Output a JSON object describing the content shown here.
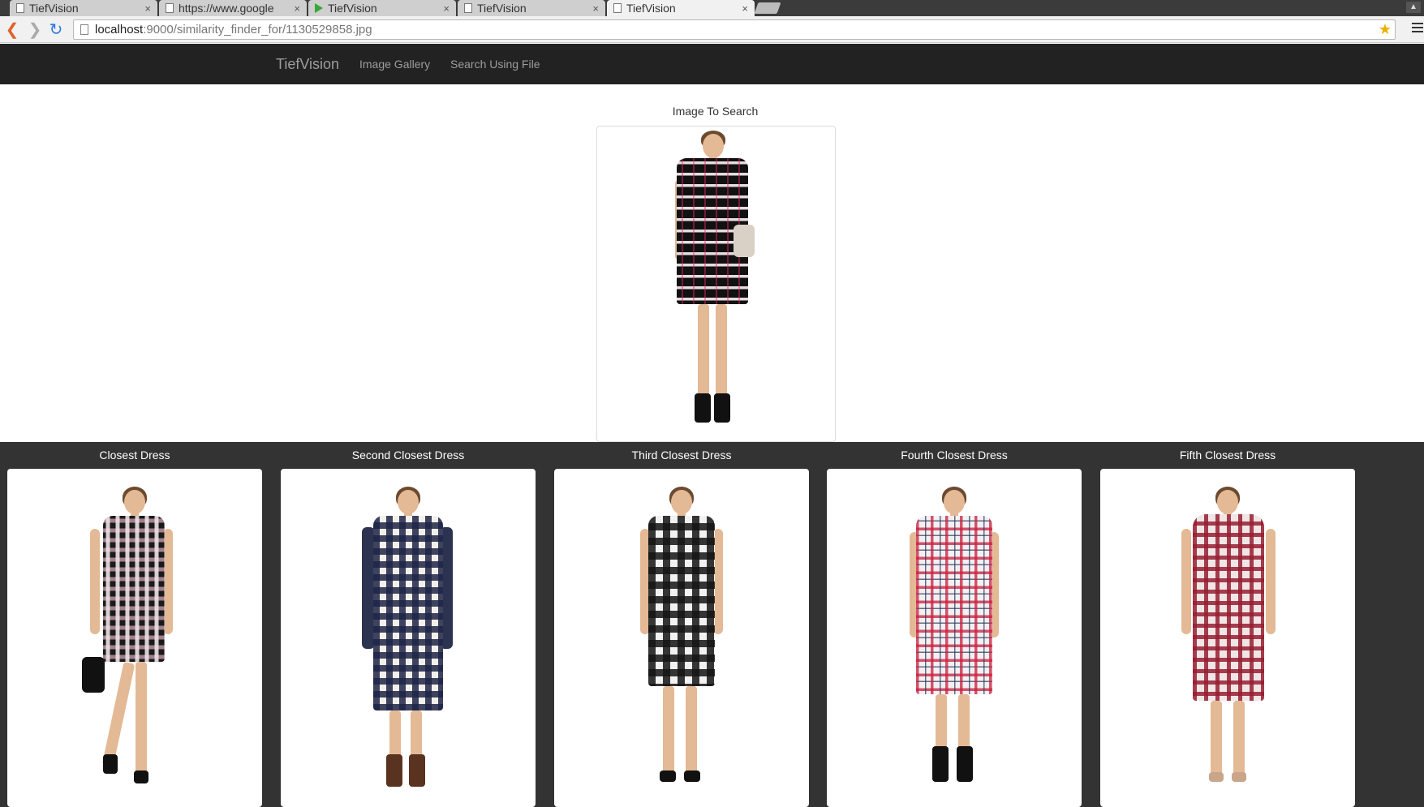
{
  "browser": {
    "tabs": [
      {
        "label": "TiefVision",
        "icon": "document-icon",
        "active": false
      },
      {
        "label": "https://www.google",
        "icon": "document-icon",
        "active": false
      },
      {
        "label": "TiefVision",
        "icon": "play-icon",
        "active": false
      },
      {
        "label": "TiefVision",
        "icon": "document-icon",
        "active": false
      },
      {
        "label": "TiefVision",
        "icon": "document-icon",
        "active": true
      }
    ],
    "tab_close_glyph": "×",
    "url_host": "localhost",
    "url_path": ":9000/similarity_finder_for/1130529858.jpg"
  },
  "navbar": {
    "brand": "TiefVision",
    "links": [
      "Image Gallery",
      "Search Using File"
    ]
  },
  "query": {
    "title": "Image To Search"
  },
  "results": [
    {
      "title": "Closest Dress"
    },
    {
      "title": "Second Closest Dress"
    },
    {
      "title": "Third Closest Dress"
    },
    {
      "title": "Fourth Closest Dress"
    },
    {
      "title": "Fifth Closest Dress"
    }
  ],
  "colors": {
    "navbar_bg": "#222222",
    "results_bg": "#333333",
    "brand_text": "#9d9d9d"
  }
}
